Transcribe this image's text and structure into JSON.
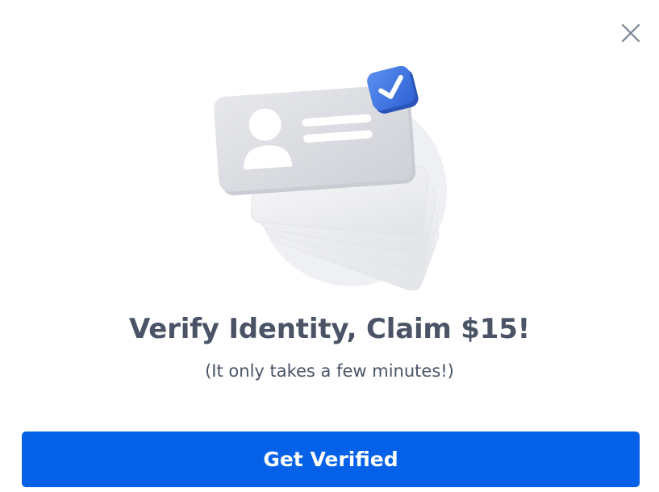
{
  "modal": {
    "title": "Verify Identity, Claim $15!",
    "subtitle": "(It only takes a few minutes!)",
    "cta_label": "Get Verified",
    "close_icon": "close-icon",
    "illustration_icon": "id-card-verified-icon"
  },
  "colors": {
    "accent": "#0561e8",
    "text": "#4a5466",
    "close": "#7b8494",
    "badge": "#3d74e2"
  }
}
